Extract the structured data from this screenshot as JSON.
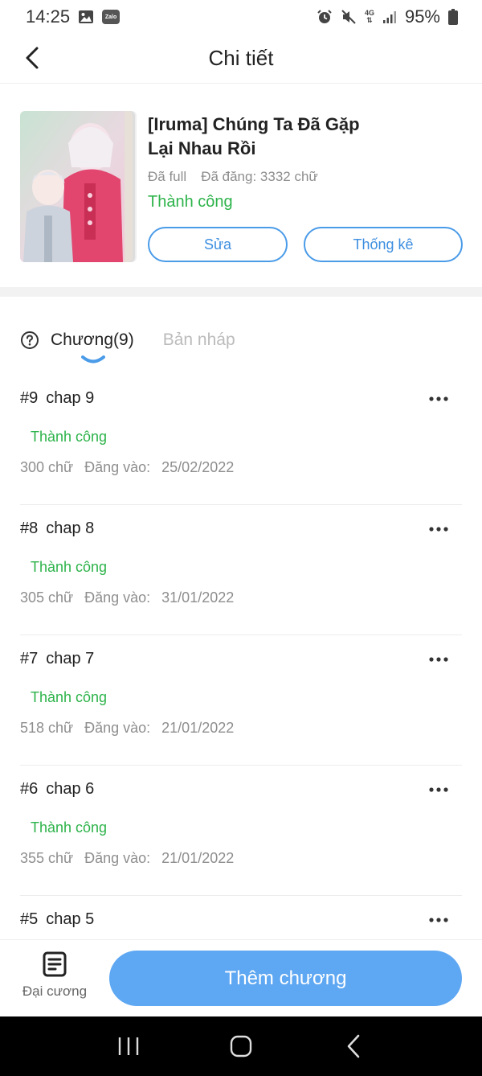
{
  "status_bar": {
    "time": "14:25",
    "zalo_label": "Zalo",
    "network": "4G",
    "battery": "95%"
  },
  "header": {
    "title": "Chi tiết"
  },
  "book": {
    "title": "[Iruma] Chúng Ta Đã Gặp Lại Nhau Rồi",
    "completion": "Đã full",
    "published": "Đã đăng: 3332 chữ",
    "status": "Thành công",
    "edit_label": "Sửa",
    "stats_label": "Thống kê"
  },
  "tabs": {
    "chapters_label": "Chương(9)",
    "drafts_label": "Bản nháp"
  },
  "chapters": [
    {
      "num": "#9",
      "title": "chap 9",
      "status": "Thành công",
      "words": "300 chữ",
      "date_label": "Đăng vào:",
      "date": "25/02/2022"
    },
    {
      "num": "#8",
      "title": "chap 8",
      "status": "Thành công",
      "words": "305 chữ",
      "date_label": "Đăng vào:",
      "date": "31/01/2022"
    },
    {
      "num": "#7",
      "title": "chap 7",
      "status": "Thành công",
      "words": "518 chữ",
      "date_label": "Đăng vào:",
      "date": "21/01/2022"
    },
    {
      "num": "#6",
      "title": "chap 6",
      "status": "Thành công",
      "words": "355 chữ",
      "date_label": "Đăng vào:",
      "date": "21/01/2022"
    },
    {
      "num": "#5",
      "title": "chap 5",
      "status": "",
      "words": "",
      "date_label": "",
      "date": ""
    }
  ],
  "bottom": {
    "outline_label": "Đại cương",
    "add_chapter_label": "Thêm chương"
  },
  "colors": {
    "accent": "#5ea7f2",
    "success": "#2db34a",
    "muted": "#8e8e8e"
  },
  "icons": {
    "back": "chevron-left-icon",
    "help": "question-circle-icon",
    "more": "more-horizontal-icon",
    "outline": "document-list-icon"
  }
}
